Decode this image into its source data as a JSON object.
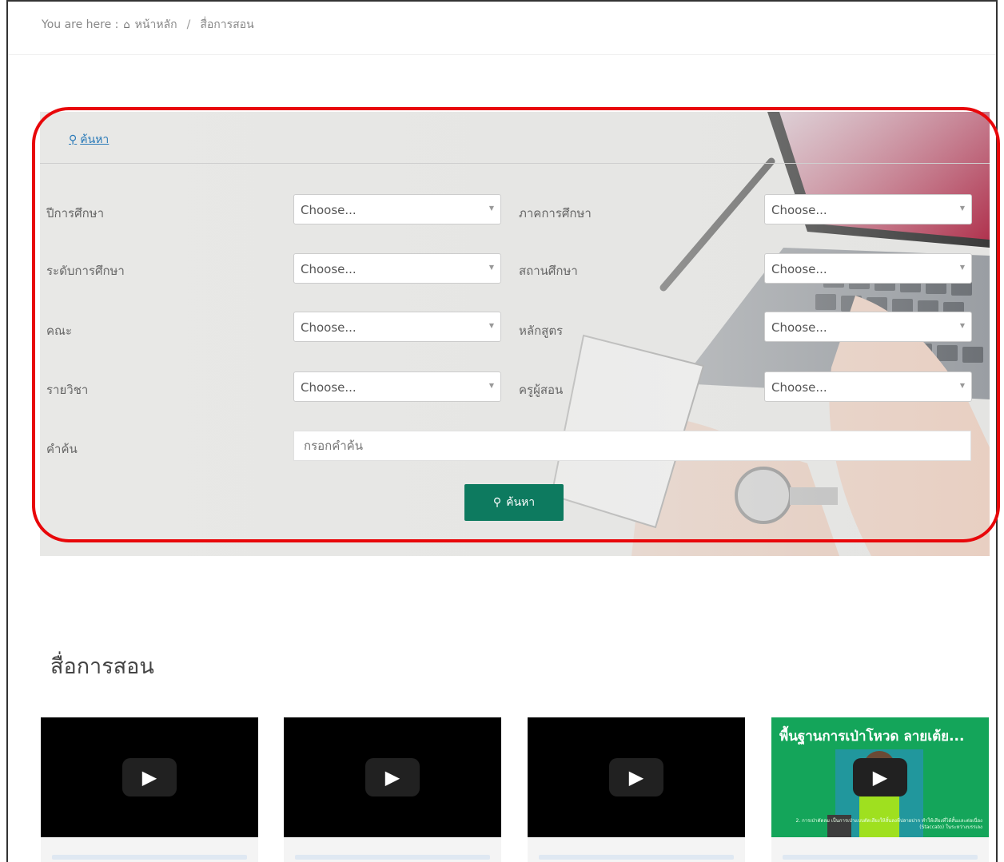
{
  "breadcrumb": {
    "prefix": "You are here :",
    "home": "หน้าหลัก",
    "separator": "/",
    "current": "สื่อการสอน"
  },
  "search_panel": {
    "header_link": "ค้นหา",
    "fields": [
      {
        "label": "ปีการศึกษา",
        "value": "Choose..."
      },
      {
        "label": "ภาคการศึกษา",
        "value": "Choose..."
      },
      {
        "label": "ระดับการศึกษา",
        "value": "Choose..."
      },
      {
        "label": "สถานศึกษา",
        "value": "Choose..."
      },
      {
        "label": "คณะ",
        "value": "Choose..."
      },
      {
        "label": "หลักสูตร",
        "value": "Choose..."
      },
      {
        "label": "รายวิชา",
        "value": "Choose..."
      },
      {
        "label": "ครูผู้สอน",
        "value": "Choose..."
      }
    ],
    "keyword_label": "คำค้น",
    "keyword_placeholder": "กรอกคำค้น",
    "submit_label": "ค้นหา"
  },
  "section_title": "สื่อการสอน",
  "cards": [
    {
      "video_title": "",
      "caption": ""
    },
    {
      "video_title": "",
      "caption": ""
    },
    {
      "video_title": "",
      "caption": ""
    },
    {
      "video_title": "พื้นฐานการเป่าโหวด ลายเต้ย...",
      "caption": "2. การเป่าตัดลม เป็นการเป่าแบบตัดเสียงให้สั้นลงที่ปลายปาก ทำให้เสียงที่ได้สั้นและต่อเนื่อง (Staccato) ในระหว่างบรรเลง"
    }
  ],
  "colors": {
    "accent": "#0d7a5f",
    "highlight": "#e8070a",
    "link": "#2a7ab8"
  }
}
